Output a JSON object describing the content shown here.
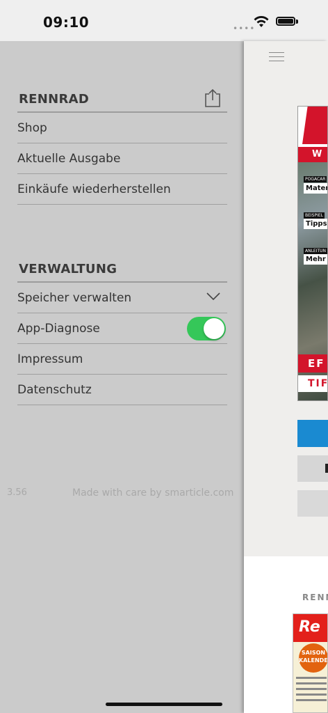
{
  "status_bar": {
    "time": "09:10"
  },
  "drawer": {
    "section1": {
      "title": "RENNRAD",
      "items": [
        {
          "label": "Shop"
        },
        {
          "label": "Aktuelle Ausgabe"
        },
        {
          "label": "Einkäufe wiederherstellen"
        }
      ]
    },
    "section2": {
      "title": "VERWALTUNG",
      "items": [
        {
          "label": "Speicher verwalten"
        },
        {
          "label": "App-Diagnose",
          "toggle_on": true
        },
        {
          "label": "Impressum"
        },
        {
          "label": "Datenschutz"
        }
      ]
    },
    "version": "3.56",
    "credit": "Made with care by smarticle.com"
  },
  "main": {
    "cover": {
      "band": "W",
      "tag1_small": "POGACAR",
      "tag1": "Materi",
      "tag2_small": "BEISPIEL",
      "tag2": "Tipps:",
      "tag3_small": "ANLEITUN",
      "tag3": "Mehr A",
      "ef": "EF",
      "tip": "TIF"
    },
    "brand": "RENN",
    "cover2": {
      "logo": "Re",
      "badge": "SAISON KALENDER"
    }
  },
  "colors": {
    "toggle_on": "#35c759",
    "drawer_bg": "#cbcbcb",
    "accent_blue": "#1a8ad1",
    "brand_red": "#d3142b"
  }
}
